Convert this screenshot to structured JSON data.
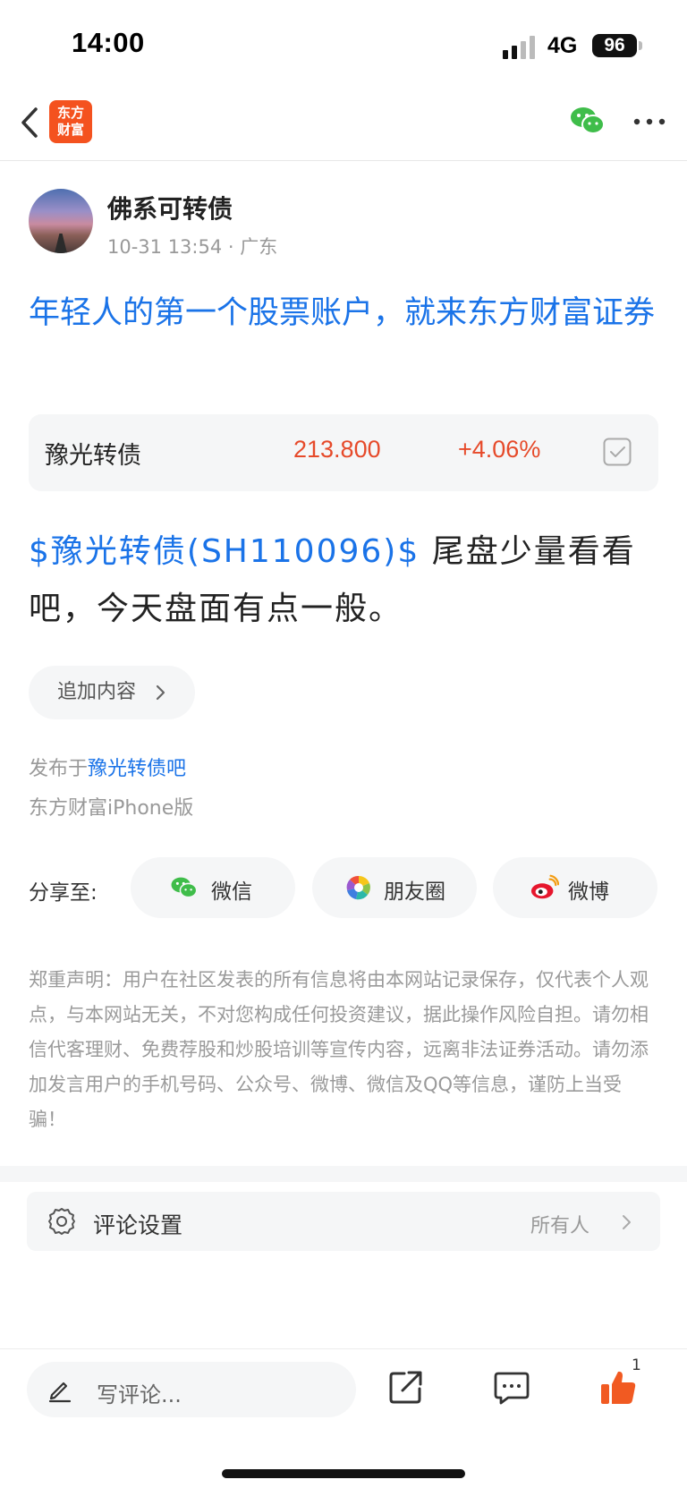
{
  "status_bar": {
    "time": "14:00",
    "network": "4G",
    "battery": "96"
  },
  "nav": {
    "logo_line1": "东方",
    "logo_line2": "财富"
  },
  "author": {
    "name": "佛系可转债",
    "meta": "10-31 13:54 · 广东"
  },
  "post": {
    "title": "年轻人的第一个股票账户，就来东方财富证券",
    "stock_tag": "$豫光转债(SH110096)$",
    "body_text": "  尾盘少量看看吧，今天盘面有点一般。"
  },
  "stock_card": {
    "name": "豫光转债",
    "price": "213.800",
    "change": "+4.06%",
    "change_color": "#e64a2a"
  },
  "add_content": {
    "label": "追加内容"
  },
  "publish": {
    "prefix": "发布于",
    "forum": "豫光转债吧",
    "client": "东方财富iPhone版"
  },
  "share": {
    "label": "分享至:",
    "buttons": [
      {
        "label": "微信",
        "icon": "wechat-icon"
      },
      {
        "label": "朋友圈",
        "icon": "moments-icon"
      },
      {
        "label": "微博",
        "icon": "weibo-icon"
      }
    ]
  },
  "disclaimer": "郑重声明：用户在社区发表的所有信息将由本网站记录保存，仅代表个人观点，与本网站无关，不对您构成任何投资建议，据此操作风险自担。请勿相信代客理财、免费荐股和炒股培训等宣传内容，远离非法证券活动。请勿添加发言用户的手机号码、公众号、微博、微信及QQ等信息，谨防上当受骗！",
  "comment_settings": {
    "label": "评论设置",
    "value": "所有人"
  },
  "bottom_bar": {
    "comment_placeholder": "写评论...",
    "like_count": "1"
  },
  "colors": {
    "accent": "#1a73e8",
    "up": "#e64a2a",
    "brand": "#f4521f",
    "like": "#f15a22"
  }
}
